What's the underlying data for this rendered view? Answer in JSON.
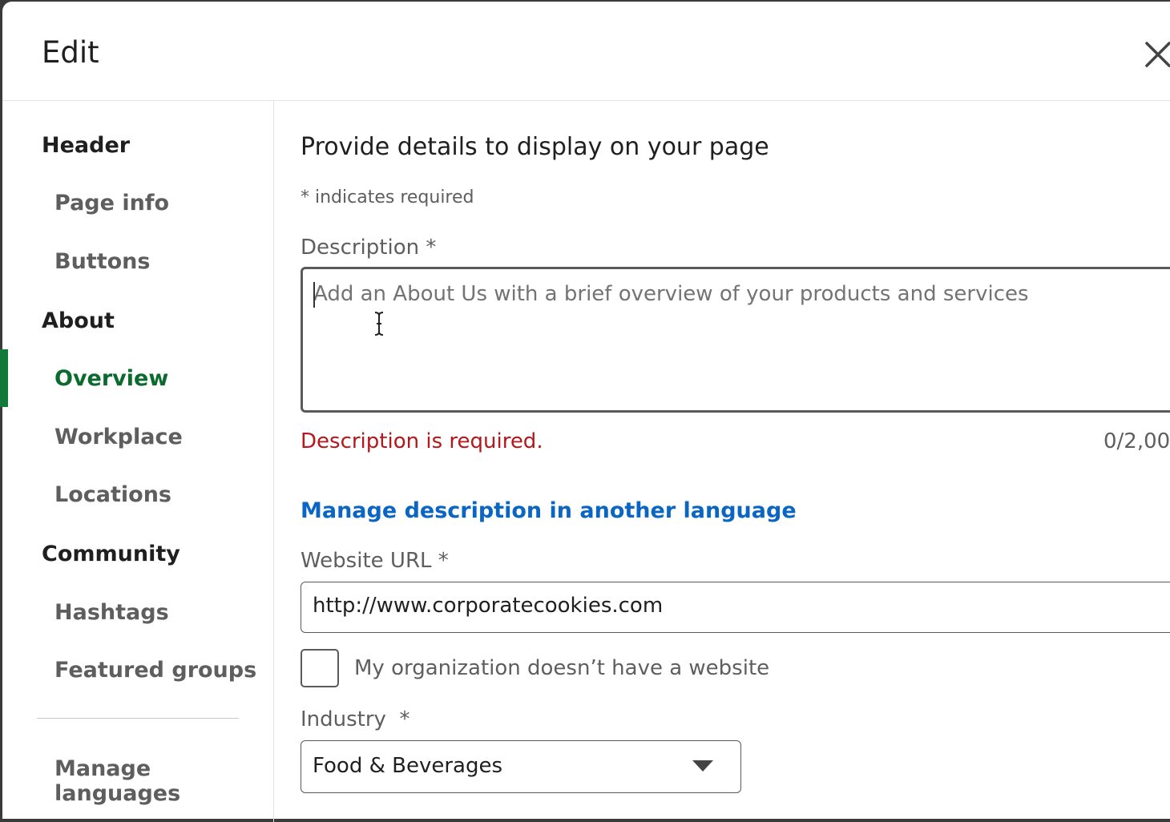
{
  "modal": {
    "title": "Edit"
  },
  "sidebar": {
    "sections": [
      {
        "label": "Header",
        "items": [
          {
            "label": "Page info"
          },
          {
            "label": "Buttons"
          }
        ]
      },
      {
        "label": "About",
        "items": [
          {
            "label": "Overview",
            "active": true
          },
          {
            "label": "Workplace"
          },
          {
            "label": "Locations"
          }
        ]
      },
      {
        "label": "Community",
        "items": [
          {
            "label": "Hashtags"
          },
          {
            "label": "Featured groups"
          }
        ]
      }
    ],
    "footer_item": "Manage languages",
    "active_color": "#117a38"
  },
  "content": {
    "heading": "Provide details to display on your page",
    "required_note": "* indicates required",
    "description": {
      "label": "Description *",
      "placeholder": "Add an About Us with a brief overview of your products and services",
      "value": "",
      "error": "Description is required.",
      "counter": "0/2,00"
    },
    "manage_link": "Manage description in another language",
    "website": {
      "label": "Website URL *",
      "value": "http://www.corporatecookies.com"
    },
    "no_website_checkbox": {
      "label": "My organization doesn’t have a website",
      "checked": false
    },
    "industry": {
      "label": "Industry  *",
      "value": "Food & Beverages"
    }
  },
  "colors": {
    "error": "#b7161a",
    "link": "#0a66c2",
    "active_nav": "#0b6b2e"
  }
}
